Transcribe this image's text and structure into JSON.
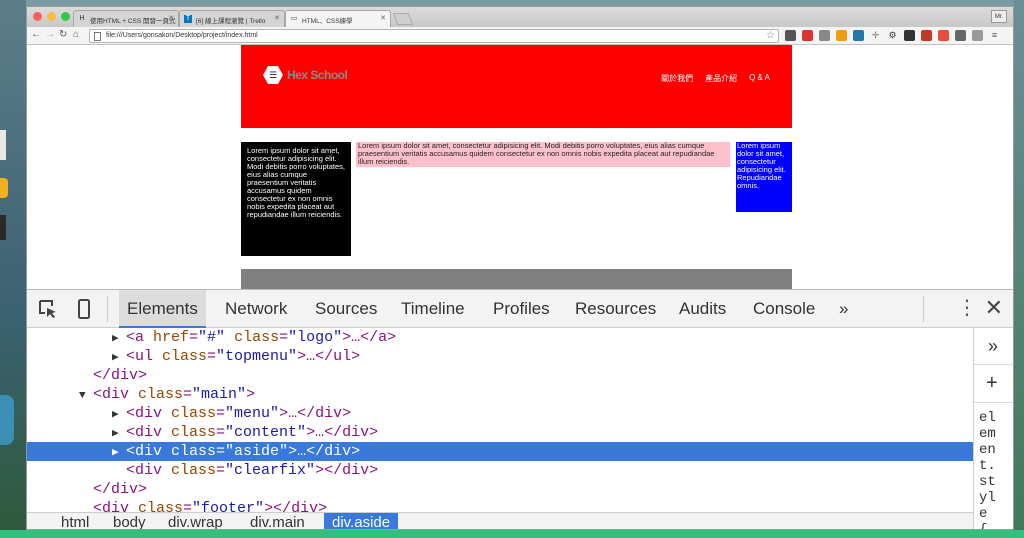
{
  "browser": {
    "tabs": [
      {
        "label": "使用HTML + CSS 開發一頁式",
        "favicon": "H"
      },
      {
        "label": "[6] 線上課程瀏覽 | Trello",
        "favicon": "T"
      },
      {
        "label": "HTML、CSS練學",
        "favicon": "▭"
      }
    ],
    "active_tab": 2,
    "user_button": "Mr.",
    "url": "file:///Users/gonsakon/Desktop/project/index.html"
  },
  "page": {
    "logo_text": "Hex School",
    "menu": [
      "關於我們",
      "產品介紹",
      "Q & A"
    ],
    "menu_text": "Lorem ipsum dolor sit amet, consectetur adipisicing elit. Modi debitis porro voluptates, eius alias cumque praesentium veritatis accusamus quidem consectetur ex non omnis nobis expedita placeat aut repudiandae illum reiciendis.",
    "content_text": "Lorem ipsum dolor sit amet, consectetur adipisicing elit. Modi debitis porro voluptates, eius alias cumque praesentium veritatis accusamus quidem consectetur ex non omnis nobis expedita placeat aut repudiandae illum reiciendis.",
    "aside_text": "Lorem ipsum dolor sit amet, consectetur adipisicing elit. Repudiandae omnis.",
    "colors": {
      "header": "#ff0000",
      "menu": "#000000",
      "content": "#ffc0cb",
      "aside": "#0000ff",
      "footer": "#808080"
    }
  },
  "devtools": {
    "tabs": [
      "Elements",
      "Network",
      "Sources",
      "Timeline",
      "Profiles",
      "Resources",
      "Audits",
      "Console"
    ],
    "more": "»",
    "close": "✕",
    "tree": [
      {
        "indent": 3,
        "tri": "▶",
        "open": "<a",
        "attrs": [
          {
            "n": "href",
            "v": "\"#\""
          },
          {
            "n": "class",
            "v": "\"logo\""
          }
        ],
        "tail": ">…</a>",
        "close_tag": "",
        "sel": false
      },
      {
        "indent": 3,
        "tri": "▶",
        "open": "<ul",
        "attrs": [
          {
            "n": "class",
            "v": "\"topmenu\""
          }
        ],
        "tail": ">…</ul>",
        "close_tag": "",
        "sel": false
      },
      {
        "indent": 2,
        "tri": "",
        "open": "</div>",
        "attrs": [],
        "tail": "",
        "close_tag": "",
        "sel": false
      },
      {
        "indent": 2,
        "tri": "▼",
        "open": "<div",
        "attrs": [
          {
            "n": "class",
            "v": "\"main\""
          }
        ],
        "tail": ">",
        "close_tag": "",
        "sel": false
      },
      {
        "indent": 3,
        "tri": "▶",
        "open": "<div",
        "attrs": [
          {
            "n": "class",
            "v": "\"menu\""
          }
        ],
        "tail": ">…</div>",
        "close_tag": "",
        "sel": false
      },
      {
        "indent": 3,
        "tri": "▶",
        "open": "<div",
        "attrs": [
          {
            "n": "class",
            "v": "\"content\""
          }
        ],
        "tail": ">…</div>",
        "close_tag": "",
        "sel": false
      },
      {
        "indent": 3,
        "tri": "▶",
        "open": "<div",
        "attrs": [
          {
            "n": "class",
            "v": "\"aside\""
          }
        ],
        "tail": ">…</div>",
        "close_tag": "",
        "sel": true
      },
      {
        "indent": 3,
        "tri": "",
        "open": "<div",
        "attrs": [
          {
            "n": "class",
            "v": "\"clearfix\""
          }
        ],
        "tail": "></div>",
        "close_tag": "",
        "sel": false
      },
      {
        "indent": 2,
        "tri": "",
        "open": "</div>",
        "attrs": [],
        "tail": "",
        "close_tag": "",
        "sel": false
      },
      {
        "indent": 2,
        "tri": "",
        "open": "<div",
        "attrs": [
          {
            "n": "class",
            "v": "\"footer\""
          }
        ],
        "tail": "></div>",
        "close_tag": "",
        "sel": false
      }
    ],
    "side_chevron": "»",
    "side_plus": "+",
    "side_text": "element.style {",
    "breadcrumbs": [
      "html",
      "body",
      "div.wrap",
      "div.main",
      "div.aside"
    ],
    "active_crumb": 4
  }
}
